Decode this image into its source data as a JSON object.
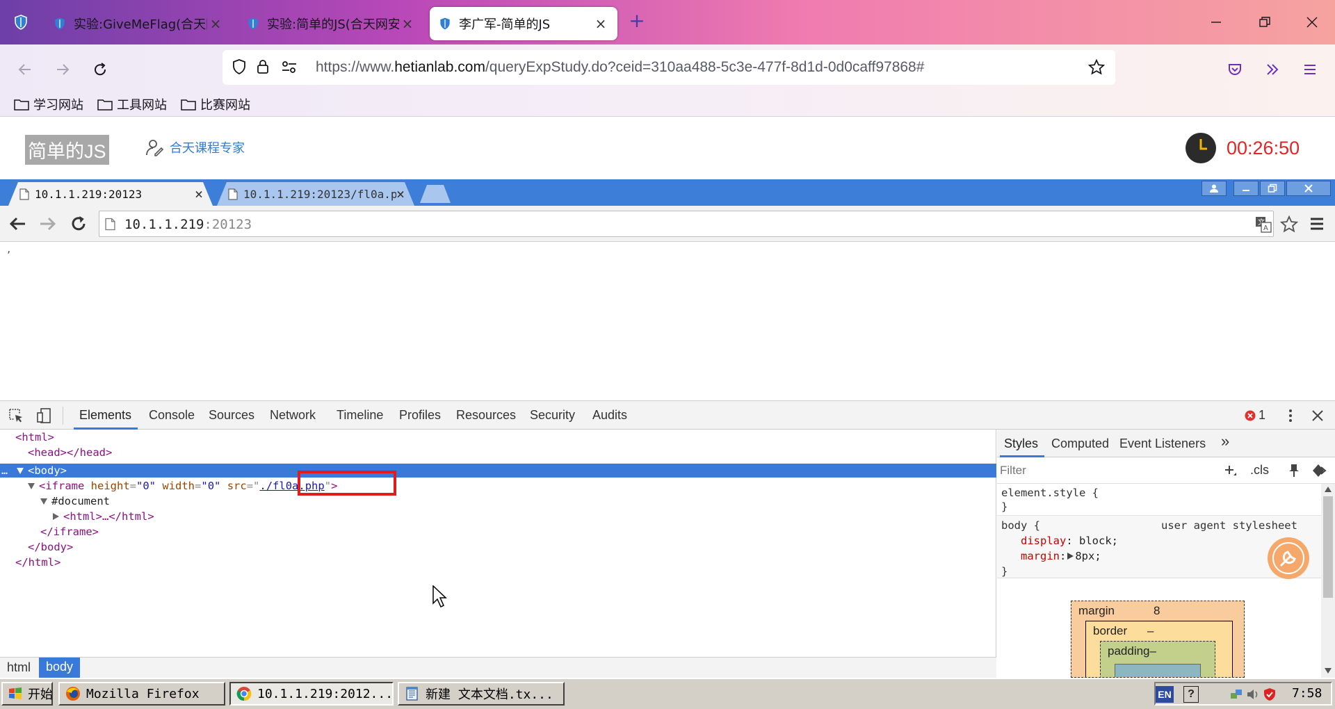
{
  "firefox": {
    "tabs": [
      {
        "title": "实验:GiveMeFlag(合天网安实验"
      },
      {
        "title": "实验:简单的JS(合天网安实验室)"
      },
      {
        "title": "李广军-简单的JS"
      }
    ],
    "close_glyph": "×",
    "new_tab_glyph": "+",
    "url": {
      "prefix": "https://www.",
      "domain": "hetianlab.com",
      "path": "/queryExpStudy.do?ceid=310aa488-5c3e-477f-8d1d-0d0caff97868#"
    },
    "bookmarks": [
      {
        "label": "学习网站"
      },
      {
        "label": "工具网站"
      },
      {
        "label": "比赛网站"
      }
    ]
  },
  "lab": {
    "title": "简单的JS",
    "expert_label": "合天课程专家",
    "timer": "00:26:50",
    "timer_color": "#e02727"
  },
  "chrome": {
    "tabs": [
      {
        "title": "10.1.1.219:20123"
      },
      {
        "title": "10.1.1.219:20123/fl0a.p"
      }
    ],
    "close_glyph": "×",
    "url_host": "10.1.1.219",
    "url_port": ":20123",
    "page_mark": "‚"
  },
  "devtools": {
    "tabs": [
      "Elements",
      "Console",
      "Sources",
      "Network",
      "Timeline",
      "Profiles",
      "Resources",
      "Security",
      "Audits"
    ],
    "active_tab": "Elements",
    "error_count": "1",
    "dom": {
      "html_open": "<html>",
      "head": "<head></head>",
      "body_open": "<body>",
      "iframe_tag": "<iframe",
      "attr_height_name": "height",
      "attr_height_value": "\"0\"",
      "attr_width_name": "width",
      "attr_width_value": "\"0\"",
      "attr_src_name": "src",
      "attr_src_value": "./fl0a.php",
      "iframe_close_bracket": ">",
      "document": "#document",
      "inner_html": "<html>…</html>",
      "iframe_close": "</iframe>",
      "body_close": "</body>",
      "html_close": "</html>",
      "ellipsis": "…"
    },
    "breadcrumbs": [
      "html",
      "body"
    ],
    "styles": {
      "tabs": [
        "Styles",
        "Computed",
        "Event Listeners"
      ],
      "more_glyph": "»",
      "filter_placeholder": "Filter",
      "cls_label": ".cls",
      "element_style": "element.style {",
      "close_brace": "}",
      "body_selector": "body {",
      "ua_label": "user agent stylesheet",
      "rules": [
        {
          "prop": "display",
          "value": "block;"
        },
        {
          "prop": "margin",
          "value": "8px;"
        }
      ],
      "box": {
        "margin_label": "margin",
        "margin_value": "8",
        "border_label": "border",
        "border_value": "–",
        "padding_label": "padding–"
      }
    }
  },
  "taskbar": {
    "start_label": "开始",
    "items": [
      {
        "label": "Mozilla Firefox"
      },
      {
        "label": "10.1.1.219:2012..."
      },
      {
        "label": "新建 文本文档.tx..."
      }
    ],
    "lang": "EN",
    "help": "?",
    "clock": "7:58"
  }
}
